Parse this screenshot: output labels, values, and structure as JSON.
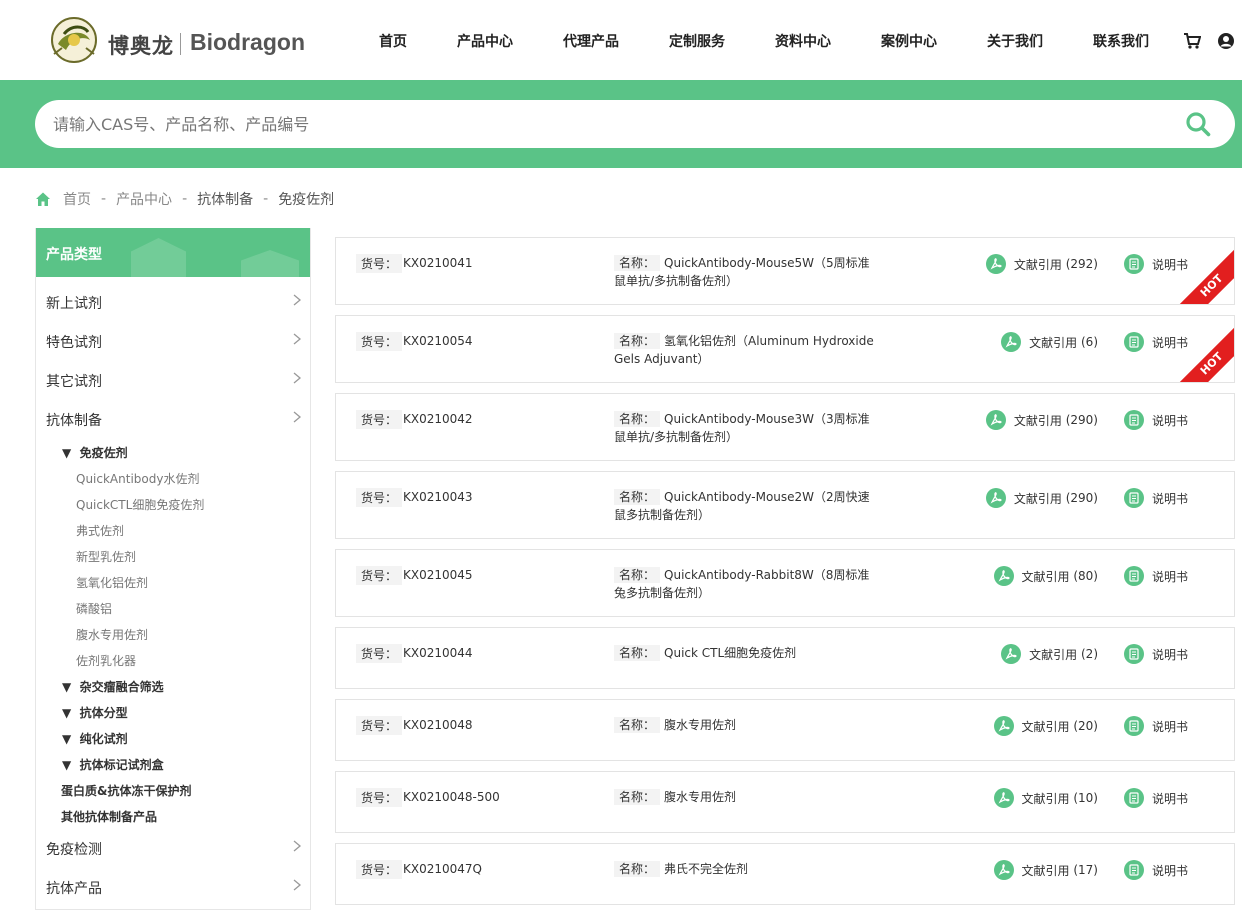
{
  "brand": {
    "cn": "博奥龙",
    "en": "Biodragon"
  },
  "nav": [
    "首页",
    "产品中心",
    "代理产品",
    "定制服务",
    "资料中心",
    "案例中心",
    "关于我们",
    "联系我们"
  ],
  "header_icons": [
    "cart-icon",
    "user-icon"
  ],
  "search": {
    "placeholder": "请输入CAS号、产品名称、产品编号",
    "icon": "search-icon"
  },
  "breadcrumb": {
    "items": [
      "首页",
      "产品中心",
      "抗体制备",
      "免疫佐剂"
    ],
    "separator": "-"
  },
  "sidebar": {
    "title": "产品类型",
    "categories": [
      "新上试剂",
      "特色试剂",
      "其它试剂",
      "抗体制备"
    ],
    "active_group": "免疫佐剂",
    "active_items": [
      "QuickAntibody水佐剂",
      "QuickCTL细胞免疫佐剂",
      "弗式佐剂",
      "新型乳佐剂",
      "氢氧化铝佐剂",
      "磷酸铝",
      "腹水专用佐剂",
      "佐剂乳化器"
    ],
    "groups": [
      "杂交瘤融合筛选",
      "抗体分型",
      "纯化试剂",
      "抗体标记试剂盒"
    ],
    "plain": [
      "蛋白质&抗体冻干保护剂",
      "其他抗体制备产品"
    ],
    "bottom_categories": [
      "免疫检测",
      "抗体产品"
    ]
  },
  "labels": {
    "code": "货号：",
    "name": "名称：",
    "cite": "文献引用",
    "manual": "说明书",
    "hot": "HOT"
  },
  "products": [
    {
      "code": "KX0210041",
      "name": "QuickAntibody-Mouse5W（5周标准鼠单抗/多抗制备佐剂）",
      "cites": "(292)",
      "hot": true
    },
    {
      "code": "KX0210054",
      "name": "氢氧化铝佐剂（Aluminum Hydroxide Gels Adjuvant）",
      "cites": "(6)",
      "hot": true
    },
    {
      "code": "KX0210042",
      "name": "QuickAntibody-Mouse3W（3周标准鼠单抗/多抗制备佐剂）",
      "cites": "(290)",
      "hot": false
    },
    {
      "code": "KX0210043",
      "name": "QuickAntibody-Mouse2W（2周快速鼠多抗制备佐剂）",
      "cites": "(290)",
      "hot": false
    },
    {
      "code": "KX0210045",
      "name": "QuickAntibody-Rabbit8W（8周标准兔多抗制备佐剂）",
      "cites": "(80)",
      "hot": false
    },
    {
      "code": "KX0210044",
      "name": "Quick CTL细胞免疫佐剂",
      "cites": "(2)",
      "hot": false
    },
    {
      "code": "KX0210048",
      "name": "腹水专用佐剂",
      "cites": "(20)",
      "hot": false
    },
    {
      "code": "KX0210048-500",
      "name": "腹水专用佐剂",
      "cites": "(10)",
      "hot": false
    },
    {
      "code": "KX0210047Q",
      "name": "弗氏不完全佐剂",
      "cites": "(17)",
      "hot": false
    }
  ],
  "colors": {
    "accent": "#5ac387",
    "hot": "#e21f1f"
  }
}
